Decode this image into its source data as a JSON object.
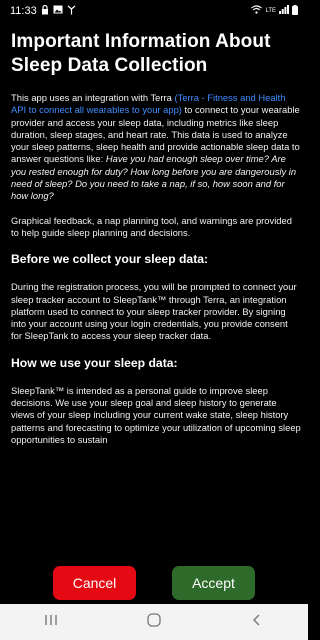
{
  "status_bar": {
    "time": "11:33",
    "icons_left": [
      "lock-icon",
      "image-icon",
      "antenna-icon"
    ],
    "icons_right": [
      "wifi-icon",
      "signal-icon",
      "battery-icon"
    ],
    "signal_label": "LTE"
  },
  "dialog": {
    "title": "Important Information About Sleep Data Collection",
    "intro": {
      "before_link": "This app uses an integration with Terra ",
      "link_text": "(Terra - Fitness and Health API to connect all wearables to your app)",
      "after_link": " to connect to your wearable provider and access your sleep data, including metrics like sleep duration, sleep stages, and heart rate. This data is used to analyze your sleep patterns, sleep health and provide actionable sleep data to answer questions like: ",
      "questions": "Have you had enough sleep over time? Are you rested enough for duty? How long before you are dangerously in need of sleep? Do you need to take a nap, if so, how soon and for how long?"
    },
    "feedback_paragraph": "Graphical feedback, a nap planning tool, and warnings are provided to help guide sleep planning and decisions.",
    "section1": {
      "heading": "Before we collect your sleep data:",
      "body": "During the registration process, you will be prompted to connect your sleep tracker account to SleepTank™ through Terra, an integration platform used to connect to your sleep tracker provider. By signing into your account using your login credentials, you provide consent for SleepTank to access your sleep tracker data."
    },
    "section2": {
      "heading": "How we use your sleep data:",
      "body": "SleepTank™ is intended as a personal guide to improve sleep decisions.  We use your sleep goal and sleep history to generate views of your sleep including your current wake state, sleep history patterns and forecasting to optimize your utilization of upcoming sleep opportunities to sustain"
    }
  },
  "buttons": {
    "cancel_label": "Cancel",
    "accept_label": "Accept",
    "cancel_color": "#e50914",
    "accept_color": "#2e6b2a"
  },
  "nav": {
    "recents_icon": "recents-icon",
    "home_icon": "home-icon",
    "back_icon": "back-icon"
  }
}
